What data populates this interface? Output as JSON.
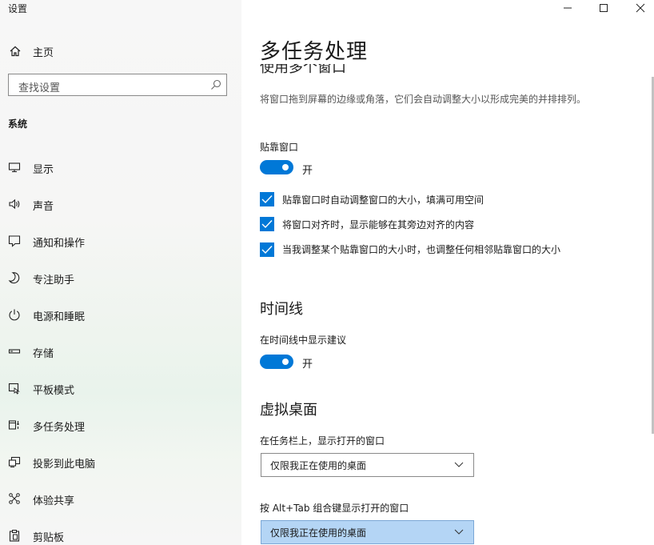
{
  "window": {
    "title": "设置",
    "controls": [
      "minimize",
      "maximize",
      "close"
    ]
  },
  "sidebar": {
    "home_label": "主页",
    "search_placeholder": "查找设置",
    "section_title": "系统",
    "items": [
      {
        "label": "显示",
        "icon": "monitor-icon"
      },
      {
        "label": "声音",
        "icon": "speaker-icon"
      },
      {
        "label": "通知和操作",
        "icon": "notification-icon"
      },
      {
        "label": "专注助手",
        "icon": "moon-icon"
      },
      {
        "label": "电源和睡眠",
        "icon": "power-icon"
      },
      {
        "label": "存储",
        "icon": "storage-icon"
      },
      {
        "label": "平板模式",
        "icon": "tablet-icon"
      },
      {
        "label": "多任务处理",
        "icon": "multitask-icon",
        "selected": true
      },
      {
        "label": "投影到此电脑",
        "icon": "project-icon"
      },
      {
        "label": "体验共享",
        "icon": "share-icon"
      },
      {
        "label": "剪贴板",
        "icon": "clipboard-icon"
      }
    ]
  },
  "main": {
    "page_title": "多任务处理",
    "snap": {
      "cut_heading": "使用多个窗口",
      "description": "将窗口拖到屏幕的边缘或角落，它们会自动调整大小以形成完美的并排排列。",
      "toggle_label": "贴靠窗口",
      "toggle_state": "开",
      "checkboxes": [
        {
          "label": "贴靠窗口时自动调整窗口的大小，填满可用空间",
          "checked": true
        },
        {
          "label": "将窗口对齐时，显示能够在其旁边对齐的内容",
          "checked": true
        },
        {
          "label": "当我调整某个贴靠窗口的大小时，也调整任何相邻贴靠窗口的大小",
          "checked": true
        }
      ]
    },
    "timeline": {
      "heading": "时间线",
      "toggle_label": "在时间线中显示建议",
      "toggle_state": "开"
    },
    "virtual_desktops": {
      "heading": "虚拟桌面",
      "taskbar_label": "在任务栏上，显示打开的窗口",
      "taskbar_value": "仅限我正在使用的桌面",
      "alttab_label": "按 Alt+Tab 组合键显示打开的窗口",
      "alttab_value": "仅限我正在使用的桌面"
    }
  },
  "colors": {
    "accent": "#0078d7",
    "dropdown_highlight": "#b4d5f5"
  }
}
